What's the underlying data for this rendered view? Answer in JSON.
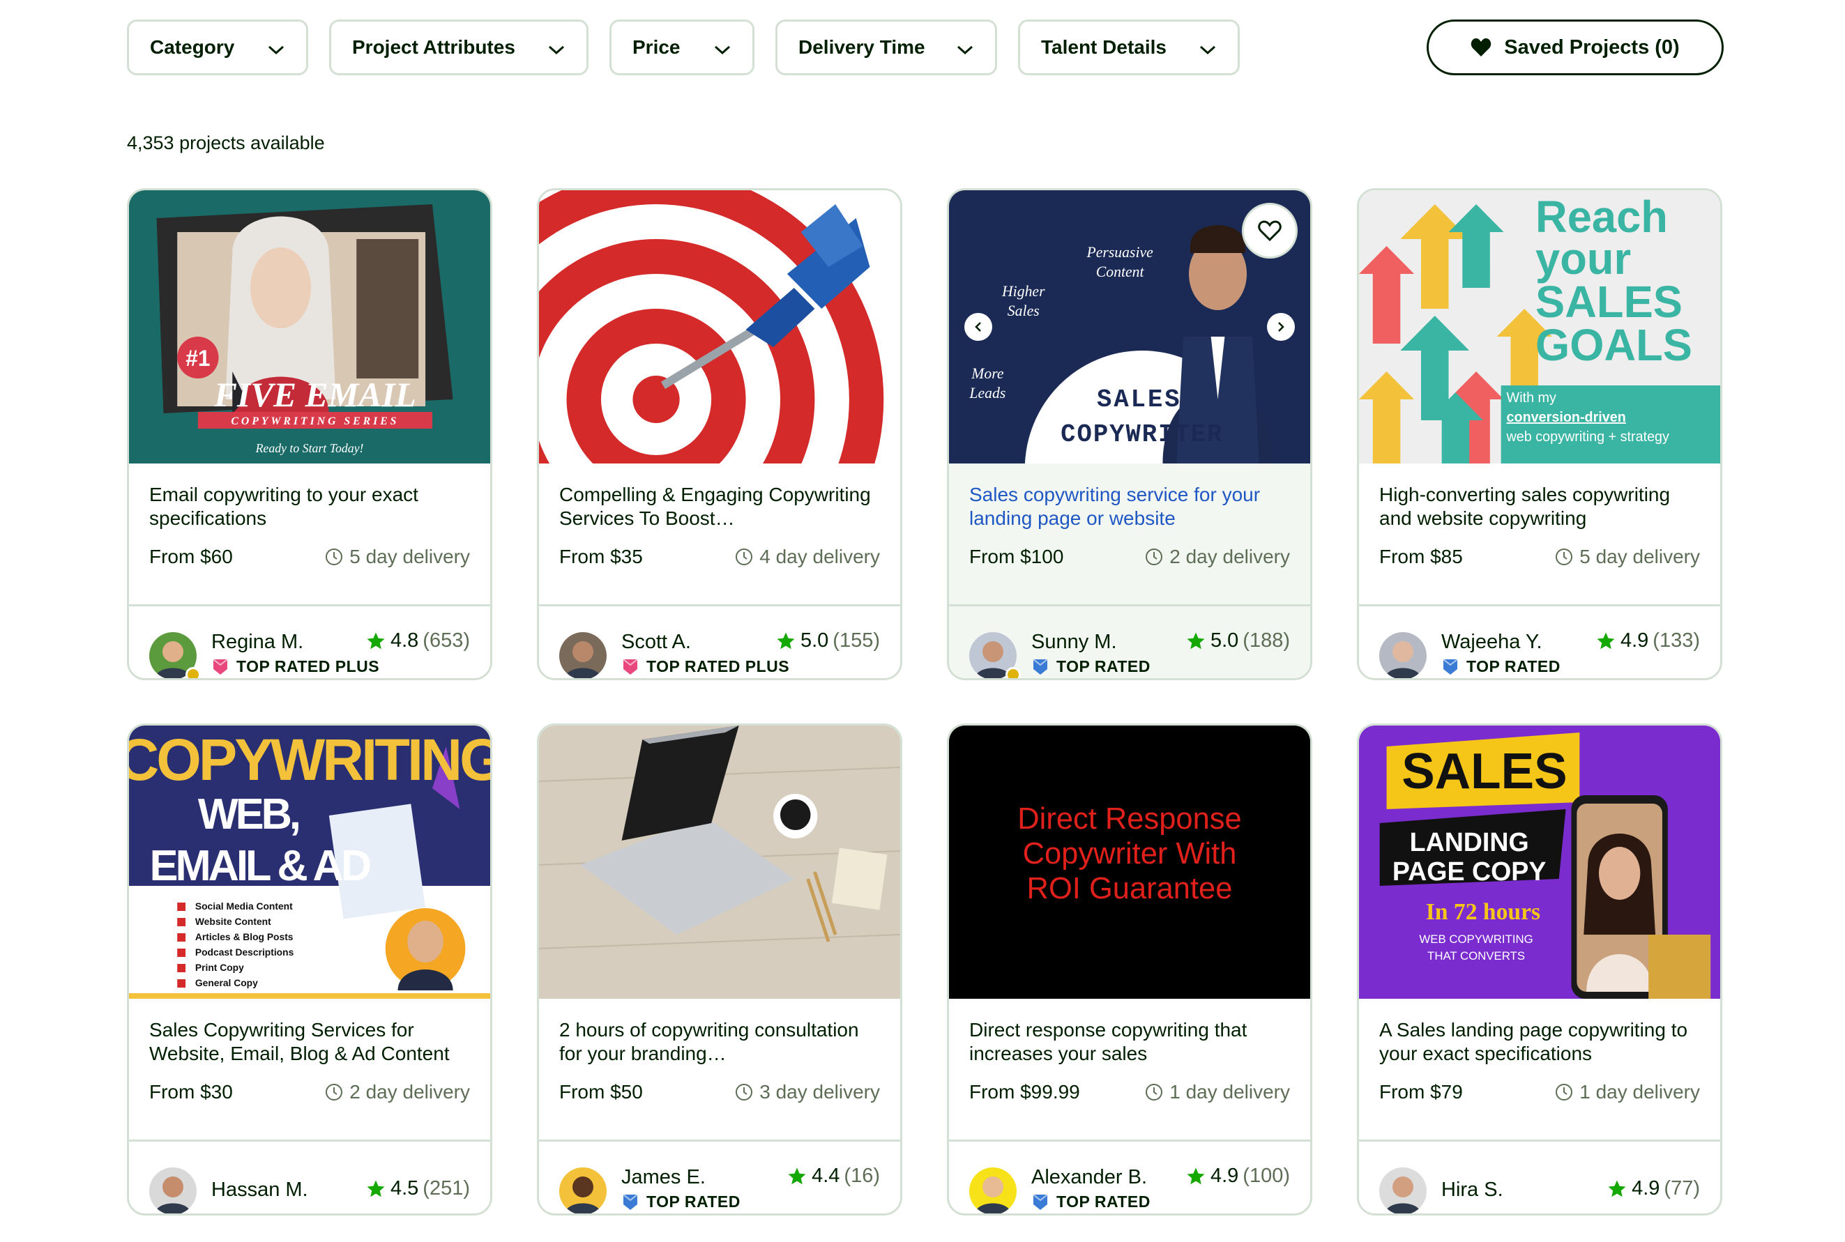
{
  "filters": {
    "category": "Category",
    "project_attributes": "Project Attributes",
    "price": "Price",
    "delivery_time": "Delivery Time",
    "talent_details": "Talent Details"
  },
  "saved_projects_label": "Saved Projects (0)",
  "projects_count": "4,353 projects available",
  "colors": {
    "text": "#001e00",
    "muted": "#5e6d55",
    "border": "#d5e0d5",
    "star": "#14a800",
    "top_rated_plus": "#e8487e",
    "top_rated": "#3a7bd5",
    "link": "#1f57c3"
  },
  "cards": [
    {
      "title": "Email copywriting to your exact specifications",
      "price": "From $60",
      "delivery": "5 day delivery",
      "seller": "Regina M.",
      "badge": "TOP RATED PLUS",
      "badge_type": "plus",
      "rating": "4.8",
      "reviews": "(653)",
      "thumb_text": {
        "rank": "#1",
        "headline": "FIVE EMAIL",
        "series": "COPYWRITING SERIES",
        "tagline": "Ready to Start Today!"
      }
    },
    {
      "title": "Compelling & Engaging Copywriting Services To Boost…",
      "price": "From $35",
      "delivery": "4 day delivery",
      "seller": "Scott A.",
      "badge": "TOP RATED PLUS",
      "badge_type": "plus",
      "rating": "5.0",
      "reviews": "(155)"
    },
    {
      "title": "Sales copywriting service for your landing page or website",
      "price": "From $100",
      "delivery": "2 day delivery",
      "seller": "Sunny M.",
      "badge": "TOP RATED",
      "badge_type": "rated",
      "rating": "5.0",
      "reviews": "(188)",
      "thumb_text": {
        "line1": "Persuasive",
        "line2": "Content",
        "line3": "Higher",
        "line4": "Sales",
        "line5": "More",
        "line6": "Leads",
        "big1": "SALES",
        "big2": "COPYWRITER"
      }
    },
    {
      "title": "High-converting sales copywriting and website copywriting",
      "price": "From $85",
      "delivery": "5 day delivery",
      "seller": "Wajeeha Y.",
      "badge": "TOP RATED",
      "badge_type": "rated",
      "rating": "4.9",
      "reviews": "(133)",
      "thumb_text": {
        "l1": "Reach",
        "l2": "your",
        "l3": "SALES",
        "l4": "GOALS",
        "s1": "With my",
        "s2": "conversion-driven",
        "s3": "web copywriting + strategy"
      }
    },
    {
      "title": "Sales Copywriting Services for Website, Email, Blog & Ad Content",
      "price": "From $30",
      "delivery": "2 day delivery",
      "seller": "Hassan M.",
      "badge": "",
      "badge_type": "none",
      "rating": "4.5",
      "reviews": "(251)",
      "thumb_text": {
        "h1": "COPYWRITING",
        "h2": "WEB,",
        "h3": "EMAIL & AD",
        "i1": "Social Media Content",
        "i2": "Website Content",
        "i3": "Articles & Blog Posts",
        "i4": "Podcast Descriptions",
        "i5": "Print Copy",
        "i6": "General Copy"
      }
    },
    {
      "title": "2 hours of copywriting consultation for your branding…",
      "price": "From $50",
      "delivery": "3 day delivery",
      "seller": "James E.",
      "badge": "TOP RATED",
      "badge_type": "rated",
      "rating": "4.4",
      "reviews": "(16)"
    },
    {
      "title": "Direct response copywriting that increases your sales",
      "price": "From $99.99",
      "delivery": "1 day delivery",
      "seller": "Alexander B.",
      "badge": "TOP RATED",
      "badge_type": "rated",
      "rating": "4.9",
      "reviews": "(100)",
      "thumb_text": {
        "l1": "Direct Response",
        "l2": "Copywriter With",
        "l3": "ROI Guarantee"
      }
    },
    {
      "title": "A Sales landing page copywriting to your exact specifications",
      "price": "From $79",
      "delivery": "1 day delivery",
      "seller": "Hira S.",
      "badge": "",
      "badge_type": "none",
      "rating": "4.9",
      "reviews": "(77)",
      "thumb_text": {
        "l1": "SALES",
        "l2": "LANDING",
        "l3": "PAGE COPY",
        "l4": "In 72 hours",
        "l5": "WEB COPYWRITING",
        "l6": "THAT CONVERTS"
      }
    }
  ]
}
